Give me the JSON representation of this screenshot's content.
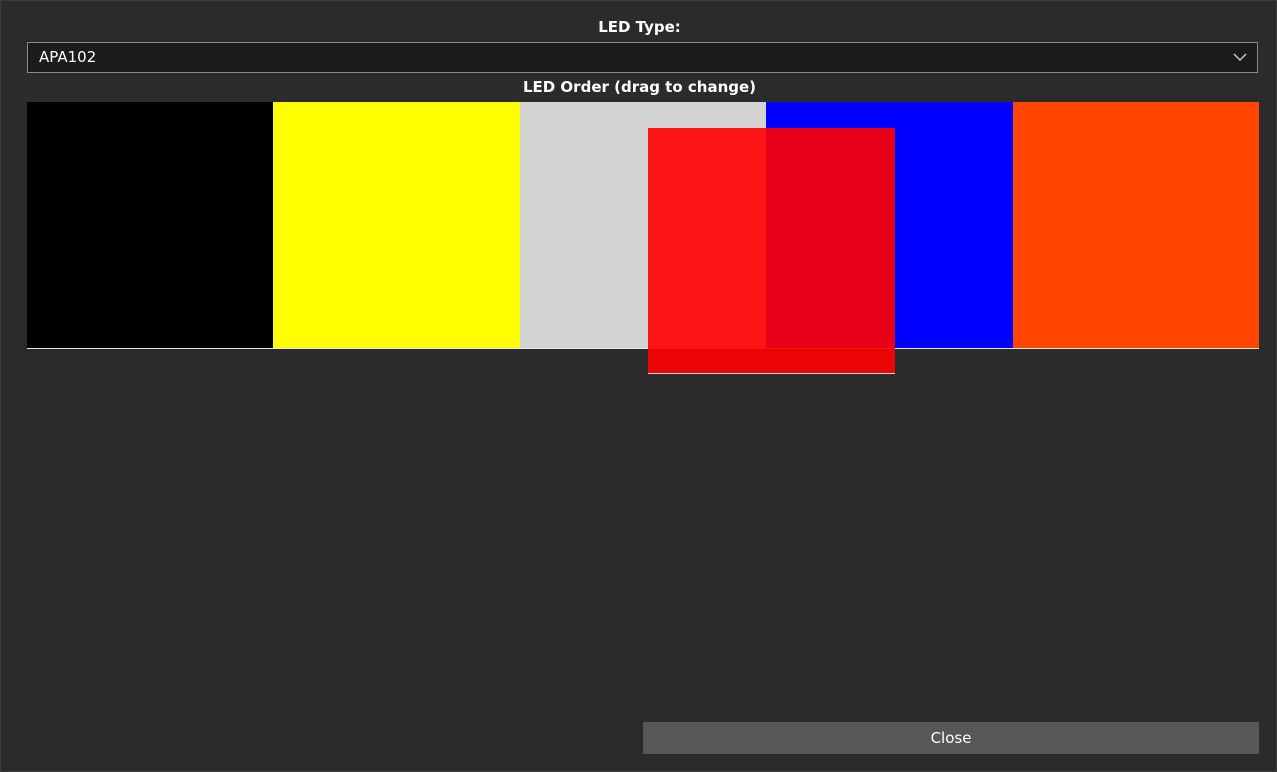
{
  "led_type": {
    "label": "LED Type:",
    "selected": "APA102"
  },
  "led_order": {
    "label": "LED Order (drag to change)",
    "swatches": [
      {
        "name": "black",
        "color": "#000000"
      },
      {
        "name": "yellow",
        "color": "#ffff00"
      },
      {
        "name": "white",
        "color": "#d3d3d3"
      },
      {
        "name": "blue",
        "color": "#0000ff"
      },
      {
        "name": "orange",
        "color": "#ff4500"
      }
    ],
    "dragging": {
      "name": "red",
      "color": "#ff0000"
    }
  },
  "close_label": "Close"
}
